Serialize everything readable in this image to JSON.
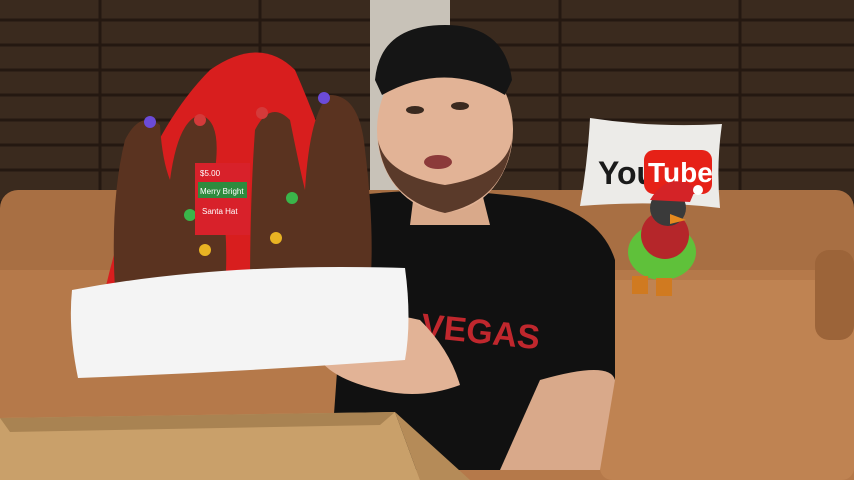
{
  "scene": {
    "pillow_brand_left": "You",
    "pillow_brand_right": "Tube",
    "hat_tag_line1": "Merry Bright",
    "hat_tag_line2": "Santa Hat",
    "hat_tag_price": "$5.00",
    "shirt_print": "VEGAS"
  },
  "colors": {
    "wall": "#2b1e15",
    "shutter": "#3a2a1e",
    "sofa": "#b5794a",
    "hat_red": "#d81e1e",
    "hat_fur": "#f4f4f4",
    "antler": "#5a3320",
    "shirt": "#111111",
    "box": "#c9a06a",
    "yt_red": "#e62117"
  }
}
